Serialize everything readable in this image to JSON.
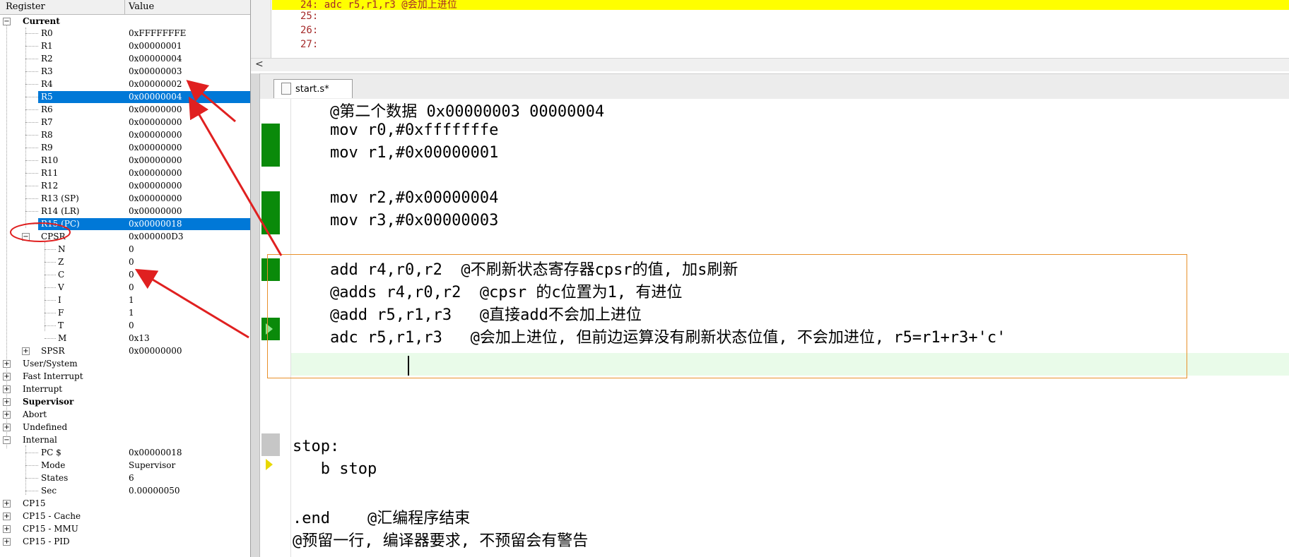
{
  "register_panel": {
    "header": {
      "col1": "Register",
      "col2": "Value"
    },
    "current_label": "Current",
    "registers": [
      {
        "name": "R0",
        "value": "0xFFFFFFFE"
      },
      {
        "name": "R1",
        "value": "0x00000001"
      },
      {
        "name": "R2",
        "value": "0x00000004"
      },
      {
        "name": "R3",
        "value": "0x00000003"
      },
      {
        "name": "R4",
        "value": "0x00000002"
      },
      {
        "name": "R5",
        "value": "0x00000004"
      },
      {
        "name": "R6",
        "value": "0x00000000"
      },
      {
        "name": "R7",
        "value": "0x00000000"
      },
      {
        "name": "R8",
        "value": "0x00000000"
      },
      {
        "name": "R9",
        "value": "0x00000000"
      },
      {
        "name": "R10",
        "value": "0x00000000"
      },
      {
        "name": "R11",
        "value": "0x00000000"
      },
      {
        "name": "R12",
        "value": "0x00000000"
      },
      {
        "name": "R13 (SP)",
        "value": "0x00000000"
      },
      {
        "name": "R14 (LR)",
        "value": "0x00000000"
      },
      {
        "name": "R15 (PC)",
        "value": "0x00000018"
      }
    ],
    "cpsr": {
      "name": "CPSR",
      "value": "0x000000D3"
    },
    "cpsr_flags": [
      {
        "name": "N",
        "value": "0"
      },
      {
        "name": "Z",
        "value": "0"
      },
      {
        "name": "C",
        "value": "0"
      },
      {
        "name": "V",
        "value": "0"
      },
      {
        "name": "I",
        "value": "1"
      },
      {
        "name": "F",
        "value": "1"
      },
      {
        "name": "T",
        "value": "0"
      },
      {
        "name": "M",
        "value": "0x13"
      }
    ],
    "spsr": {
      "name": "SPSR",
      "value": "0x00000000"
    },
    "groups1": [
      "User/System",
      "Fast Interrupt",
      "Interrupt",
      "Supervisor",
      "Abort",
      "Undefined"
    ],
    "internal_label": "Internal",
    "internal": [
      {
        "name": "PC  $",
        "value": "0x00000018"
      },
      {
        "name": "Mode",
        "value": "Supervisor"
      },
      {
        "name": "States",
        "value": "6"
      },
      {
        "name": "Sec",
        "value": "0.00000050"
      }
    ],
    "groups2": [
      "CP15",
      "CP15 - Cache",
      "CP15 - MMU",
      "CP15 - PID"
    ]
  },
  "disasm_top": {
    "lines": [
      {
        "text": "24:         adc r5,r1,r3   @会加上进位"
      },
      {
        "text": "25:"
      },
      {
        "text": "26:"
      },
      {
        "text": "27:"
      }
    ]
  },
  "tab": {
    "label": "start.s*"
  },
  "code_lines": [
    "    @第二个数据 0x00000003 00000004",
    "    mov r0,#0xfffffffe",
    "    mov r1,#0x00000001",
    "",
    "    mov r2,#0x00000004",
    "    mov r3,#0x00000003",
    "",
    "    add r4,r0,r2  @不刷新状态寄存器cpsr的值, 加s刷新",
    "    @adds r4,r0,r2  @cpsr 的c位置为1, 有进位",
    "    @add r5,r1,r3   @直接add不会加上进位",
    "    adc r5,r1,r3   @会加上进位, 但前边运算没有刷新状态位值, 不会加进位, r5=r1+r3+'c'",
    "",
    "",
    "",
    "",
    "stop:",
    "   b stop",
    "",
    ".end    @汇编程序结束",
    "@预留一行, 编译器要求, 不预留会有警告"
  ],
  "colors": {
    "selection": "#0078d7",
    "breakpoint_green": "#0a8a0a",
    "annotation_red": "#e02020",
    "highlight_yellow": "#ffff00",
    "box_orange": "#e8902a"
  }
}
